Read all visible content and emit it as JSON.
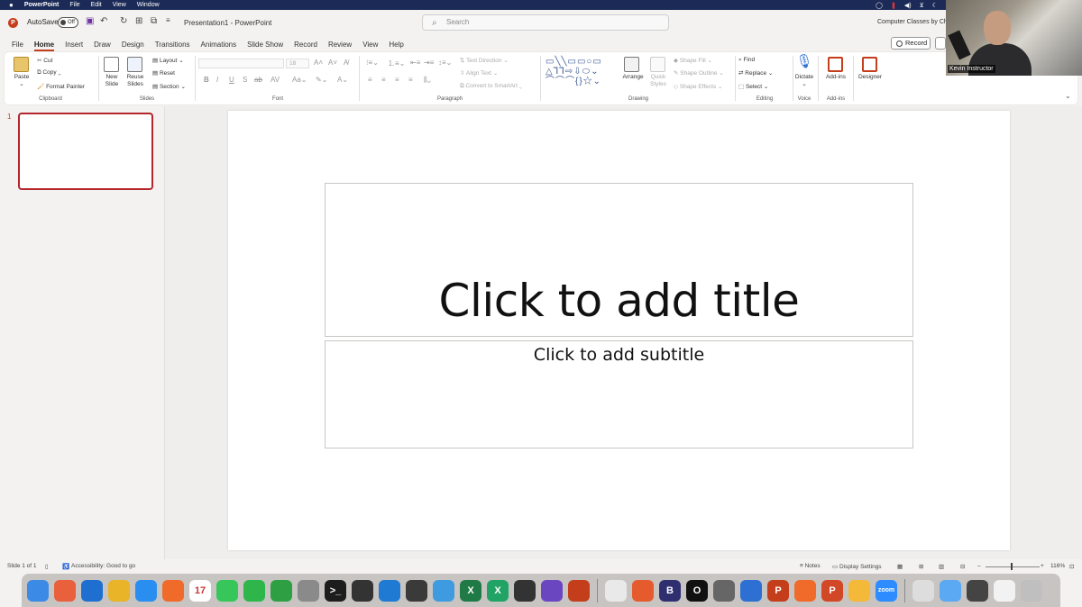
{
  "menubar": {
    "items": [
      "PowerPoint",
      "File",
      "Edit",
      "View",
      "Window"
    ],
    "right_icons": [
      "screen-record-icon",
      "wifi-icon",
      "volume-icon",
      "user-icon",
      "moon-icon"
    ]
  },
  "titlebar": {
    "autosave_label": "AutoSave",
    "autosave_state": "Off",
    "doc_title": "Presentation1 - PowerPoint",
    "search_placeholder": "Search",
    "account": "Computer Classes by Chi"
  },
  "tabs": [
    "File",
    "Home",
    "Insert",
    "Draw",
    "Design",
    "Transitions",
    "Animations",
    "Slide Show",
    "Record",
    "Review",
    "View",
    "Help"
  ],
  "active_tab": "Home",
  "record_button": "Record",
  "ribbon": {
    "clipboard": {
      "paste": "Paste",
      "cut": "Cut",
      "copy": "Copy",
      "format_painter": "Format Painter",
      "label": "Clipboard"
    },
    "slides": {
      "new_slide_1": "New",
      "new_slide_2": "Slide",
      "reuse_1": "Reuse",
      "reuse_2": "Slides",
      "layout": "Layout",
      "reset": "Reset",
      "section": "Section",
      "label": "Slides"
    },
    "font": {
      "size": "18",
      "bold": "B",
      "italic": "I",
      "underline": "U",
      "strike": "S",
      "label": "Font"
    },
    "paragraph": {
      "text_direction": "Text Direction",
      "align_text": "Align Text",
      "smartart": "Convert to SmartArt",
      "label": "Paragraph"
    },
    "drawing": {
      "arrange": "Arrange",
      "quick_styles_1": "Quick",
      "quick_styles_2": "Styles",
      "shape_fill": "Shape Fill",
      "shape_outline": "Shape Outline",
      "shape_effects": "Shape Effects",
      "label": "Drawing"
    },
    "editing": {
      "find": "Find",
      "replace": "Replace",
      "select": "Select",
      "label": "Editing"
    },
    "voice": {
      "dictate": "Dictate",
      "label": "Voice"
    },
    "addins": {
      "addins": "Add-ins",
      "label": "Add-ins"
    },
    "designer": {
      "designer": "Designer"
    }
  },
  "webcam": {
    "name": "Kevin Instructor"
  },
  "thumbnails": {
    "slide_number": "1"
  },
  "slide": {
    "title_placeholder": "Click to add title",
    "subtitle_placeholder": "Click to add subtitle"
  },
  "statusbar": {
    "slide_info": "Slide 1 of 1",
    "accessibility": "Accessibility: Good to go",
    "notes": "Notes",
    "display_settings": "Display Settings",
    "zoom": "116%"
  },
  "dock": {
    "apps": [
      {
        "name": "finder",
        "color": "#3b8ae6",
        "glyph": ""
      },
      {
        "name": "launchpad",
        "color": "#e8603c",
        "glyph": ""
      },
      {
        "name": "system-preferences-blue",
        "color": "#1f6fd1",
        "glyph": ""
      },
      {
        "name": "chrome",
        "color": "#e9b428",
        "glyph": ""
      },
      {
        "name": "safari",
        "color": "#2a8ef0",
        "glyph": ""
      },
      {
        "name": "firefox",
        "color": "#f06a2a",
        "glyph": ""
      },
      {
        "name": "calendar",
        "color": "#ffffff",
        "glyph": "17"
      },
      {
        "name": "messages",
        "color": "#37c659",
        "glyph": ""
      },
      {
        "name": "facetime",
        "color": "#2fb64b",
        "glyph": ""
      },
      {
        "name": "numbers",
        "color": "#2ea043",
        "glyph": ""
      },
      {
        "name": "system-settings",
        "color": "#8a8a8a",
        "glyph": ""
      },
      {
        "name": "terminal",
        "color": "#1d1d1d",
        "glyph": ">_"
      },
      {
        "name": "final-cut",
        "color": "#333333",
        "glyph": ""
      },
      {
        "name": "vscode",
        "color": "#1f7ad4",
        "glyph": ""
      },
      {
        "name": "quicktime",
        "color": "#3a3a3a",
        "glyph": ""
      },
      {
        "name": "affinity",
        "color": "#3f9be0",
        "glyph": ""
      },
      {
        "name": "excel",
        "color": "#1f7a45",
        "glyph": "X"
      },
      {
        "name": "excel-2",
        "color": "#21a366",
        "glyph": "X"
      },
      {
        "name": "obs",
        "color": "#333333",
        "glyph": ""
      },
      {
        "name": "keynote",
        "color": "#6b46c1",
        "glyph": ""
      },
      {
        "name": "utility",
        "color": "#c43e1c",
        "glyph": ""
      },
      {
        "name": "textedit",
        "color": "#e9e9e9",
        "glyph": ""
      },
      {
        "name": "pencil-app",
        "color": "#e55b2d",
        "glyph": ""
      },
      {
        "name": "bbedit",
        "color": "#2f2f70",
        "glyph": "B"
      },
      {
        "name": "circle-app",
        "color": "#111111",
        "glyph": "O"
      },
      {
        "name": "screen-app",
        "color": "#666666",
        "glyph": ""
      },
      {
        "name": "windows-app",
        "color": "#2d6fd2",
        "glyph": ""
      },
      {
        "name": "powerpoint",
        "color": "#c43e1c",
        "glyph": "P"
      },
      {
        "name": "firefox-2",
        "color": "#f06a2a",
        "glyph": ""
      },
      {
        "name": "powerpoint-2",
        "color": "#d24726",
        "glyph": "P"
      },
      {
        "name": "folder",
        "color": "#f5b93a",
        "glyph": ""
      },
      {
        "name": "zoom",
        "color": "#2d8cff",
        "glyph": "zoom"
      },
      {
        "name": "document",
        "color": "#dddddd",
        "glyph": ""
      },
      {
        "name": "folder-blue",
        "color": "#5aa9f2",
        "glyph": ""
      },
      {
        "name": "screen-thumb",
        "color": "#444444",
        "glyph": ""
      },
      {
        "name": "white-window",
        "color": "#f2f2f2",
        "glyph": ""
      },
      {
        "name": "trash",
        "color": "#bfbfbf",
        "glyph": ""
      }
    ]
  }
}
